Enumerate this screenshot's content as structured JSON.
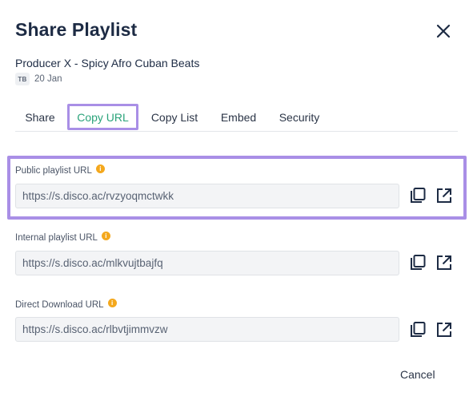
{
  "dialog": {
    "title": "Share Playlist",
    "close_icon": "close-icon"
  },
  "playlist": {
    "name": "Producer X - Spicy Afro Cuban Beats",
    "avatar_initials": "TB",
    "date": "20 Jan"
  },
  "tabs": [
    {
      "label": "Share",
      "active": false
    },
    {
      "label": "Copy URL",
      "active": true
    },
    {
      "label": "Copy List",
      "active": false
    },
    {
      "label": "Embed",
      "active": false
    },
    {
      "label": "Security",
      "active": false
    }
  ],
  "fields": [
    {
      "label": "Public playlist URL",
      "value": "https://s.disco.ac/rvzyoqmctwkk",
      "info_icon": "info-icon",
      "copy_icon": "copy-icon",
      "open_icon": "external-link-icon"
    },
    {
      "label": "Internal playlist URL",
      "value": "https://s.disco.ac/mlkvujtbajfq",
      "info_icon": "info-icon",
      "copy_icon": "copy-icon",
      "open_icon": "external-link-icon"
    },
    {
      "label": "Direct Download URL",
      "value": "https://s.disco.ac/rlbvtjimmvzw",
      "info_icon": "info-icon",
      "copy_icon": "copy-icon",
      "open_icon": "external-link-icon"
    }
  ],
  "footer": {
    "cancel_label": "Cancel"
  },
  "colors": {
    "accent_green": "#2aa37a",
    "highlight_purple": "#a98fe6",
    "info_orange": "#f4a81d",
    "title_navy": "#1d2b44"
  }
}
